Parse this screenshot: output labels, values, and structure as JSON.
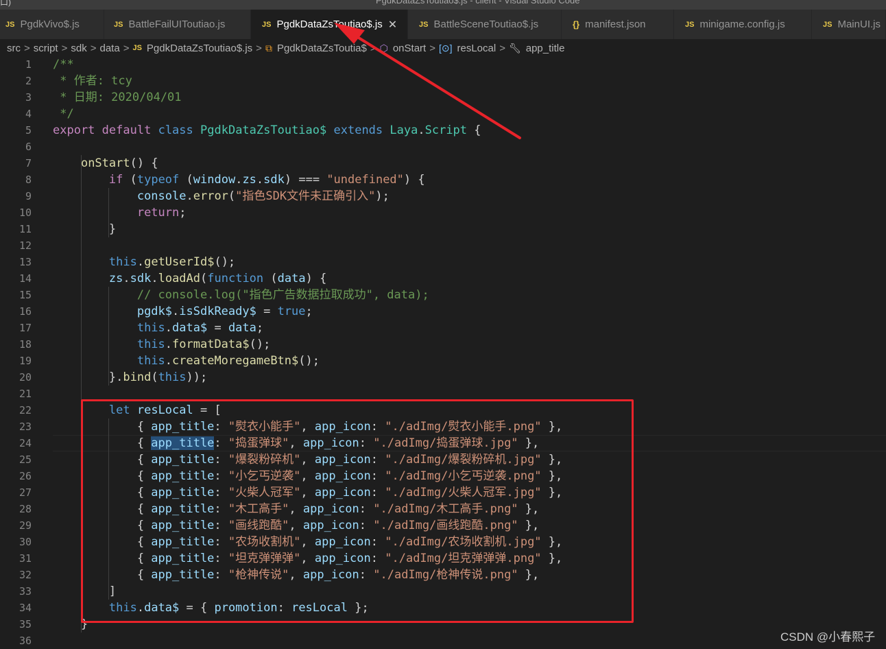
{
  "window": {
    "title": "PgdkDataZsToutiao$.js - client - Visual Studio Code",
    "corner": "口)"
  },
  "tabs": [
    {
      "label": "PgdkVivo$.js",
      "icon": "JS"
    },
    {
      "label": "BattleFailUIToutiao.js",
      "icon": "JS"
    },
    {
      "label": "PgdkDataZsToutiao$.js",
      "icon": "JS",
      "active": true
    },
    {
      "label": "BattleSceneToutiao$.js",
      "icon": "JS"
    },
    {
      "label": "manifest.json",
      "icon": "{}"
    },
    {
      "label": "minigame.config.js",
      "icon": "JS"
    },
    {
      "label": "MainUI.js",
      "icon": "JS"
    }
  ],
  "breadcrumb": {
    "items": [
      "src",
      "script",
      "sdk",
      "data",
      "PgdkDataZsToutiao$.js",
      "PgdkDataZsToutia$",
      "onStart",
      "resLocal",
      "app_title"
    ],
    "js_badge": "JS",
    "separator": ">"
  },
  "code": {
    "lines": [
      {
        "n": "1",
        "text": "/**"
      },
      {
        "n": "2",
        "text": " * 作者: tcy"
      },
      {
        "n": "3",
        "text": " * 日期: 2020/04/01"
      },
      {
        "n": "4",
        "text": " */"
      },
      {
        "n": "5",
        "text": "export default class PgdkDataZsToutiao$ extends Laya.Script {"
      },
      {
        "n": "6",
        "text": ""
      },
      {
        "n": "7",
        "text": "    onStart() {"
      },
      {
        "n": "8",
        "text": "        if (typeof (window.zs.sdk) === \"undefined\") {"
      },
      {
        "n": "9",
        "text": "            console.error(\"指色SDK文件未正确引入\");"
      },
      {
        "n": "10",
        "text": "            return;"
      },
      {
        "n": "11",
        "text": "        }"
      },
      {
        "n": "12",
        "text": ""
      },
      {
        "n": "13",
        "text": "        this.getUserId$();"
      },
      {
        "n": "14",
        "text": "        zs.sdk.loadAd(function (data) {"
      },
      {
        "n": "15",
        "text": "            // console.log(\"指色广告数据拉取成功\", data);"
      },
      {
        "n": "16",
        "text": "            pgdk$.isSdkReady$ = true;"
      },
      {
        "n": "17",
        "text": "            this.data$ = data;"
      },
      {
        "n": "18",
        "text": "            this.formatData$();"
      },
      {
        "n": "19",
        "text": "            this.createMoregameBtn$();"
      },
      {
        "n": "20",
        "text": "        }.bind(this));"
      },
      {
        "n": "21",
        "text": ""
      },
      {
        "n": "22",
        "text": "        let resLocal = ["
      },
      {
        "n": "23",
        "text": "            { app_title: \"熨衣小能手\", app_icon: \"./adImg/熨衣小能手.png\" },"
      },
      {
        "n": "24",
        "text": "            { app_title: \"捣蛋弹球\", app_icon: \"./adImg/捣蛋弹球.jpg\" },"
      },
      {
        "n": "25",
        "text": "            { app_title: \"爆裂粉碎机\", app_icon: \"./adImg/爆裂粉碎机.jpg\" },"
      },
      {
        "n": "26",
        "text": "            { app_title: \"小乞丐逆袭\", app_icon: \"./adImg/小乞丐逆袭.png\" },"
      },
      {
        "n": "27",
        "text": "            { app_title: \"火柴人冠军\", app_icon: \"./adImg/火柴人冠军.jpg\" },"
      },
      {
        "n": "28",
        "text": "            { app_title: \"木工高手\", app_icon: \"./adImg/木工高手.png\" },"
      },
      {
        "n": "29",
        "text": "            { app_title: \"画线跑酷\", app_icon: \"./adImg/画线跑酷.png\" },"
      },
      {
        "n": "30",
        "text": "            { app_title: \"农场收割机\", app_icon: \"./adImg/农场收割机.jpg\" },"
      },
      {
        "n": "31",
        "text": "            { app_title: \"坦克弹弹弹\", app_icon: \"./adImg/坦克弹弹弹.png\" },"
      },
      {
        "n": "32",
        "text": "            { app_title: \"枪神传说\", app_icon: \"./adImg/枪神传说.png\" },"
      },
      {
        "n": "33",
        "text": "        ]"
      },
      {
        "n": "34",
        "text": "        this.data$ = { promotion: resLocal };"
      },
      {
        "n": "35",
        "text": "    }"
      },
      {
        "n": "36",
        "text": ""
      }
    ]
  },
  "watermark": "CSDN @小春熙子",
  "colors": {
    "annotation_red": "#e8232a",
    "editor_bg": "#1e1e1e",
    "js_icon": "#e8c84a"
  }
}
